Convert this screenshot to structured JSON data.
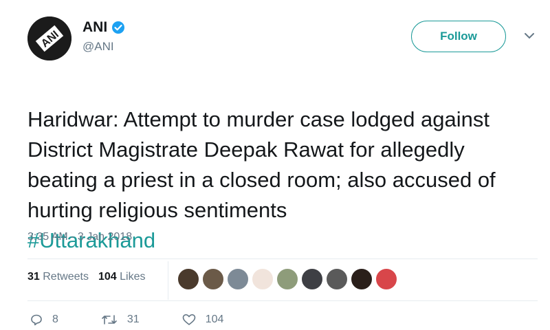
{
  "author": {
    "name": "ANI",
    "handle": "@ANI",
    "avatar_text": "ANI",
    "verified_icon": "verified-badge-icon"
  },
  "follow_button": {
    "label": "Follow"
  },
  "menu_icon": "chevron-down-icon",
  "tweet": {
    "text": "Haridwar: Attempt to murder case lodged against District Magistrate Deepak Rawat for allegedly beating a priest in a closed room; also accused of hurting religious sentiments",
    "hashtag": "#Uttarakhand",
    "timestamp": "3:35 AM - 3 Jan 2018"
  },
  "stats": {
    "retweets_count": "31",
    "retweets_label": "Retweets",
    "likes_count": "104",
    "likes_label": "Likes"
  },
  "likers": [
    {
      "color": "#4a3a2c"
    },
    {
      "color": "#6b5a48"
    },
    {
      "color": "#7d8a96"
    },
    {
      "color": "#f1e4dc"
    },
    {
      "color": "#8e9c7a"
    },
    {
      "color": "#3e3f44"
    },
    {
      "color": "#5a5a5a"
    },
    {
      "color": "#2a1f1a"
    },
    {
      "color": "#d8464a"
    }
  ],
  "actions": {
    "reply_count": "8",
    "retweet_count": "31",
    "like_count": "104"
  },
  "colors": {
    "accent": "#1b9a98",
    "verified": "#1da1f2",
    "muted": "#657786"
  }
}
